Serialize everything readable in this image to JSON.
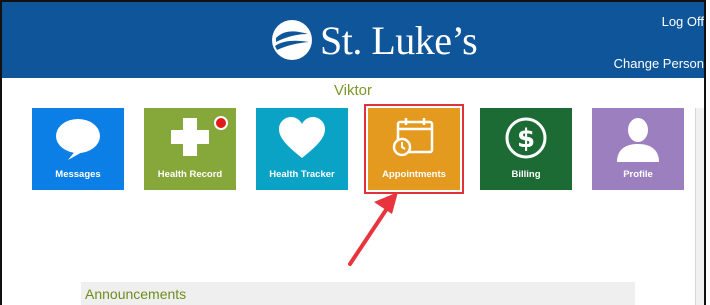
{
  "header": {
    "brand": "St. Luke’s",
    "logoff_label": "Log Off",
    "change_person_label": "Change Person"
  },
  "user": {
    "name": "Viktor"
  },
  "tiles": [
    {
      "label": "Messages",
      "icon": "speech-bubble-icon",
      "color": "#0b7fe6"
    },
    {
      "label": "Health Record",
      "icon": "medical-cross-icon",
      "color": "#86a83a",
      "has_notification": true
    },
    {
      "label": "Health Tracker",
      "icon": "heart-icon",
      "color": "#0aa3c6"
    },
    {
      "label": "Appointments",
      "icon": "calendar-clock-icon",
      "color": "#e39a1f",
      "highlighted": true
    },
    {
      "label": "Billing",
      "icon": "dollar-icon",
      "color": "#1c6b34"
    },
    {
      "label": "Profile",
      "icon": "person-silhouette-icon",
      "color": "#9b7fbf"
    }
  ],
  "announcements": {
    "title": "Announcements"
  },
  "annotation": {
    "arrow_color": "#e8343c"
  }
}
